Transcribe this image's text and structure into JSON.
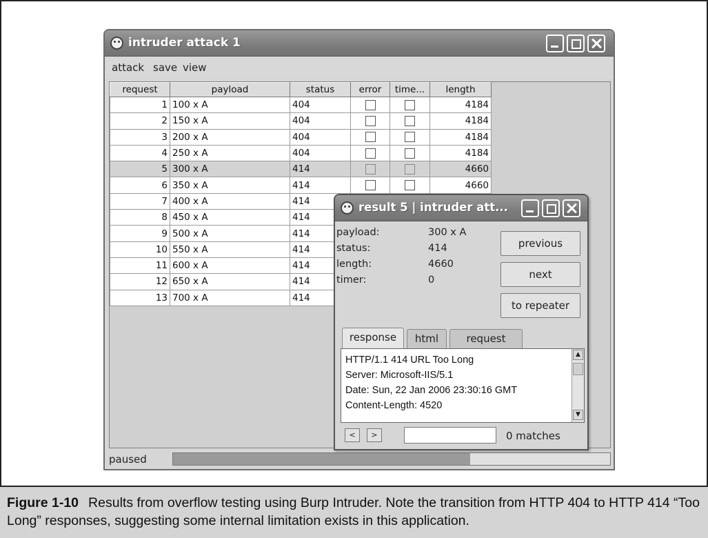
{
  "main_window": {
    "title": "intruder attack 1",
    "menu": [
      "attack",
      "save",
      "view"
    ],
    "columns": [
      "request",
      "payload",
      "status",
      "error",
      "time...",
      "length"
    ],
    "rows": [
      {
        "request": "1",
        "payload": "100 x A",
        "status": "404",
        "length": "4184",
        "selected": false
      },
      {
        "request": "2",
        "payload": "150 x A",
        "status": "404",
        "length": "4184",
        "selected": false
      },
      {
        "request": "3",
        "payload": "200 x A",
        "status": "404",
        "length": "4184",
        "selected": false
      },
      {
        "request": "4",
        "payload": "250 x A",
        "status": "404",
        "length": "4184",
        "selected": false
      },
      {
        "request": "5",
        "payload": "300 x A",
        "status": "414",
        "length": "4660",
        "selected": true
      },
      {
        "request": "6",
        "payload": "350 x A",
        "status": "414",
        "length": "4660",
        "selected": false
      },
      {
        "request": "7",
        "payload": "400 x A",
        "status": "414",
        "length": "",
        "selected": false
      },
      {
        "request": "8",
        "payload": "450 x A",
        "status": "414",
        "length": "",
        "selected": false
      },
      {
        "request": "9",
        "payload": "500 x A",
        "status": "414",
        "length": "",
        "selected": false
      },
      {
        "request": "10",
        "payload": "550 x A",
        "status": "414",
        "length": "",
        "selected": false
      },
      {
        "request": "11",
        "payload": "600 x A",
        "status": "414",
        "length": "",
        "selected": false
      },
      {
        "request": "12",
        "payload": "650 x A",
        "status": "414",
        "length": "",
        "selected": false
      },
      {
        "request": "13",
        "payload": "700 x A",
        "status": "414",
        "length": "",
        "selected": false
      }
    ],
    "status_text": "paused",
    "progress_fraction": 0.68
  },
  "result_window": {
    "title": "result 5 | intruder att...",
    "fields": [
      {
        "label": "payload:",
        "value": "300 x A"
      },
      {
        "label": "status:",
        "value": "414"
      },
      {
        "label": "length:",
        "value": "4660"
      },
      {
        "label": "timer:",
        "value": "0"
      }
    ],
    "buttons": {
      "previous": "previous",
      "next": "next",
      "to_repeater": "to repeater"
    },
    "tabs": [
      "response",
      "html",
      "request"
    ],
    "response_lines": [
      "HTTP/1.1 414 URL Too Long",
      "Server: Microsoft-IIS/5.1",
      "Date: Sun, 22 Jan 2006 23:30:16 GMT",
      "Content-Length: 4520"
    ],
    "nav_prev": "<",
    "nav_next": ">",
    "search_value": "",
    "matches": "0 matches"
  },
  "caption": {
    "label": "Figure 1-10",
    "text": "Results from overflow testing using Burp Intruder. Note the transition from HTTP 404 to HTTP 414 “Too Long” responses, suggesting some internal limitation exists in this application."
  }
}
